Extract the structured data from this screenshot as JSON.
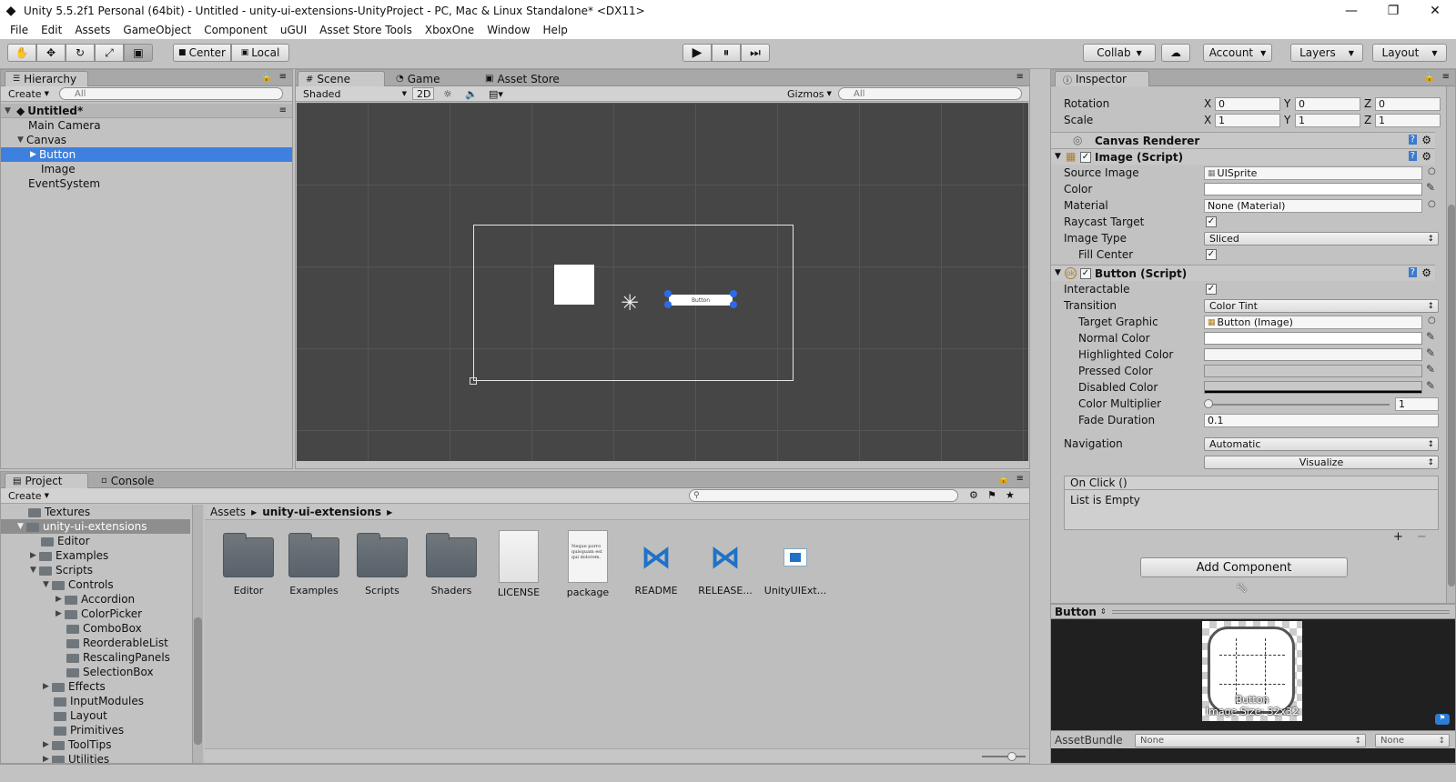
{
  "window": {
    "title": "Unity 5.5.2f1 Personal (64bit) - Untitled - unity-ui-extensions-UnityProject - PC, Mac & Linux Standalone* <DX11>",
    "minimize": "—",
    "restore": "❐",
    "close": "✕"
  },
  "menu": [
    "File",
    "Edit",
    "Assets",
    "GameObject",
    "Component",
    "uGUI",
    "Asset Store Tools",
    "XboxOne",
    "Window",
    "Help"
  ],
  "toolbar": {
    "tools": [
      "✋",
      "✥",
      "↻",
      "⤢",
      "▣"
    ],
    "pivot": "Center",
    "space": "Local",
    "play": "▶",
    "pause": "⏸",
    "step": "⏭",
    "collab": "Collab",
    "cloud": "☁",
    "account": "Account",
    "layers": "Layers",
    "layout": "Layout"
  },
  "hierarchy": {
    "tab": "Hierarchy",
    "create": "Create",
    "search_placeholder": "All",
    "scene": "Untitled*",
    "items": [
      {
        "label": "Main Camera",
        "indent": 0,
        "selected": false,
        "arrow": ""
      },
      {
        "label": "Canvas",
        "indent": 0,
        "selected": false,
        "arrow": "▼"
      },
      {
        "label": "Button",
        "indent": 1,
        "selected": true,
        "arrow": "▶"
      },
      {
        "label": "Image",
        "indent": 1,
        "selected": false,
        "arrow": ""
      },
      {
        "label": "EventSystem",
        "indent": 0,
        "selected": false,
        "arrow": ""
      }
    ]
  },
  "scene": {
    "tabs": [
      "Scene",
      "Game",
      "Asset Store"
    ],
    "shading": "Shaded",
    "mode2d": "2D",
    "gizmos": "Gizmos",
    "search_placeholder": "All",
    "button_text": "Button"
  },
  "project": {
    "tabs": [
      "Project",
      "Console"
    ],
    "create": "Create",
    "tree": [
      {
        "label": "Textures",
        "indent": 1,
        "arrow": ""
      },
      {
        "label": "unity-ui-extensions",
        "indent": 0,
        "arrow": "▼",
        "highlight": true
      },
      {
        "label": "Editor",
        "indent": 1,
        "arrow": ""
      },
      {
        "label": "Examples",
        "indent": 1,
        "arrow": "▶"
      },
      {
        "label": "Scripts",
        "indent": 1,
        "arrow": "▼"
      },
      {
        "label": "Controls",
        "indent": 2,
        "arrow": "▼"
      },
      {
        "label": "Accordion",
        "indent": 3,
        "arrow": "▶"
      },
      {
        "label": "ColorPicker",
        "indent": 3,
        "arrow": "▶"
      },
      {
        "label": "ComboBox",
        "indent": 3,
        "arrow": ""
      },
      {
        "label": "ReorderableList",
        "indent": 3,
        "arrow": ""
      },
      {
        "label": "RescalingPanels",
        "indent": 3,
        "arrow": ""
      },
      {
        "label": "SelectionBox",
        "indent": 3,
        "arrow": ""
      },
      {
        "label": "Effects",
        "indent": 2,
        "arrow": "▶"
      },
      {
        "label": "InputModules",
        "indent": 2,
        "arrow": ""
      },
      {
        "label": "Layout",
        "indent": 2,
        "arrow": ""
      },
      {
        "label": "Primitives",
        "indent": 2,
        "arrow": ""
      },
      {
        "label": "ToolTips",
        "indent": 2,
        "arrow": "▶"
      },
      {
        "label": "Utilities",
        "indent": 2,
        "arrow": "▶"
      }
    ],
    "breadcrumb": [
      "Assets",
      "unity-ui-extensions"
    ],
    "assets": [
      {
        "label": "Editor",
        "kind": "folder"
      },
      {
        "label": "Examples",
        "kind": "folder"
      },
      {
        "label": "Scripts",
        "kind": "folder"
      },
      {
        "label": "Shaders",
        "kind": "folder"
      },
      {
        "label": "LICENSE",
        "kind": "doc"
      },
      {
        "label": "package",
        "kind": "package",
        "text": "Neque porro quisquam est qui dolorem."
      },
      {
        "label": "README",
        "kind": "vs"
      },
      {
        "label": "RELEASE...",
        "kind": "vs"
      },
      {
        "label": "UnityUIExt...",
        "kind": "unity"
      }
    ]
  },
  "inspector": {
    "tab": "Inspector",
    "rotation": {
      "label": "Rotation",
      "x": "0",
      "y": "0",
      "z": "0"
    },
    "scale": {
      "label": "Scale",
      "x": "1",
      "y": "1",
      "z": "1"
    },
    "axis": [
      "X",
      "Y",
      "Z"
    ],
    "canvas_renderer": "Canvas Renderer",
    "image_script": {
      "title": "Image (Script)",
      "source_image": {
        "label": "Source Image",
        "value": "UISprite"
      },
      "color": "Color",
      "material": {
        "label": "Material",
        "value": "None (Material)"
      },
      "raycast_target": "Raycast Target",
      "image_type": {
        "label": "Image Type",
        "value": "Sliced"
      },
      "fill_center": "Fill Center"
    },
    "button_script": {
      "title": "Button (Script)",
      "interactable": "Interactable",
      "transition": {
        "label": "Transition",
        "value": "Color Tint"
      },
      "target_graphic": {
        "label": "Target Graphic",
        "value": "Button (Image)"
      },
      "normal_color": "Normal Color",
      "highlighted_color": "Highlighted Color",
      "pressed_color": "Pressed Color",
      "disabled_color": "Disabled Color",
      "color_multiplier": {
        "label": "Color Multiplier",
        "value": "1"
      },
      "fade_duration": {
        "label": "Fade Duration",
        "value": "0.1"
      },
      "navigation": {
        "label": "Navigation",
        "value": "Automatic"
      },
      "visualize": "Visualize",
      "on_click": "On Click ()",
      "list_empty": "List is Empty",
      "plus": "+",
      "minus": "−"
    },
    "add_component": "Add Component",
    "preview_title": "Button",
    "preview_caption1": "Button",
    "preview_caption2": "Image Size: 32x32",
    "assetbundle_label": "AssetBundle",
    "assetbundle_value": "None",
    "assetbundle_variant": "None"
  }
}
